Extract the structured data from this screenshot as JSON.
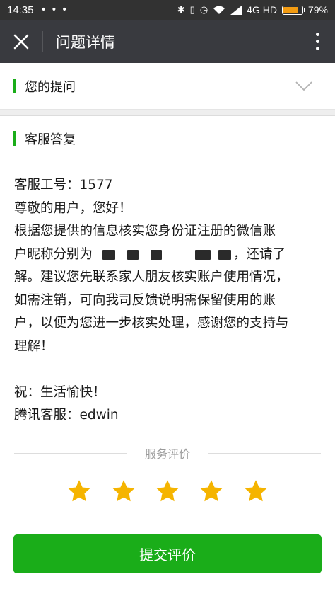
{
  "status_bar": {
    "time": "14:35",
    "dots": "• • •",
    "network": "4G HD",
    "battery_percent": "79%",
    "battery_level": 0.79,
    "battery_color": "#f39c12",
    "icons": [
      "bluetooth-icon",
      "vibrate-icon",
      "alarm-icon",
      "wifi-icon",
      "signal-icon"
    ]
  },
  "header": {
    "title": "问题详情",
    "close_icon": "close-icon",
    "more_icon": "more-vertical-icon"
  },
  "question_section": {
    "title": "您的提问",
    "expand_icon": "chevron-down-icon"
  },
  "reply_section": {
    "title": "客服答复",
    "lines": {
      "staff_id": "客服工号：1577",
      "greeting": "尊敬的用户，您好！",
      "body_1": "根据您提供的信息核实您身份证注册的微信账",
      "body_2_prefix": "户昵称分别为",
      "body_2_suffix": "，还请了",
      "body_3": "解。建议您先联系家人朋友核实账户使用情况，",
      "body_4": "如需注销，可向我司反馈说明需保留使用的账",
      "body_5": "户，以便为您进一步核实处理，感谢您的支持与",
      "body_6": "理解！",
      "wish": "祝：生活愉快！",
      "signature": "腾讯客服：edwin"
    }
  },
  "rating": {
    "label": "服务评价",
    "stars": 5,
    "max_stars": 5,
    "star_color": "#f5b400"
  },
  "submit": {
    "label": "提交评价",
    "color": "#1aad19"
  },
  "accent_color": "#1aad19"
}
